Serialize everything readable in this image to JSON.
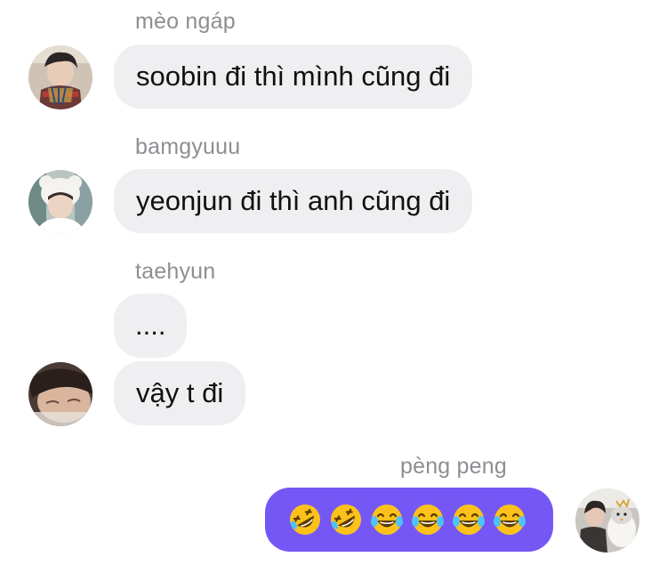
{
  "messages": [
    {
      "sender": "mèo ngáp",
      "text": "soobin đi thì mình cũng đi",
      "avatar": "avatar-photo-plaid-scarf"
    },
    {
      "sender": "bamgyuuu",
      "text": "yeonjun đi thì anh cũng đi",
      "avatar": "avatar-photo-bear-hat"
    },
    {
      "sender": "taehyun",
      "texts": [
        "....",
        "vậy t đi"
      ],
      "avatar": "avatar-photo-sleeping"
    }
  ],
  "own_message": {
    "sender": "pèng peng",
    "emojis": [
      "rolling-on-floor-laughing",
      "rolling-on-floor-laughing",
      "face-with-tears-of-joy",
      "face-with-tears-of-joy",
      "face-with-tears-of-joy",
      "face-with-tears-of-joy"
    ],
    "avatar": "avatar-photo-penguin"
  },
  "colors": {
    "incoming_bubble": "#efeff1",
    "outgoing_bubble": "#7557f6",
    "sender_name": "#8e8e93"
  }
}
